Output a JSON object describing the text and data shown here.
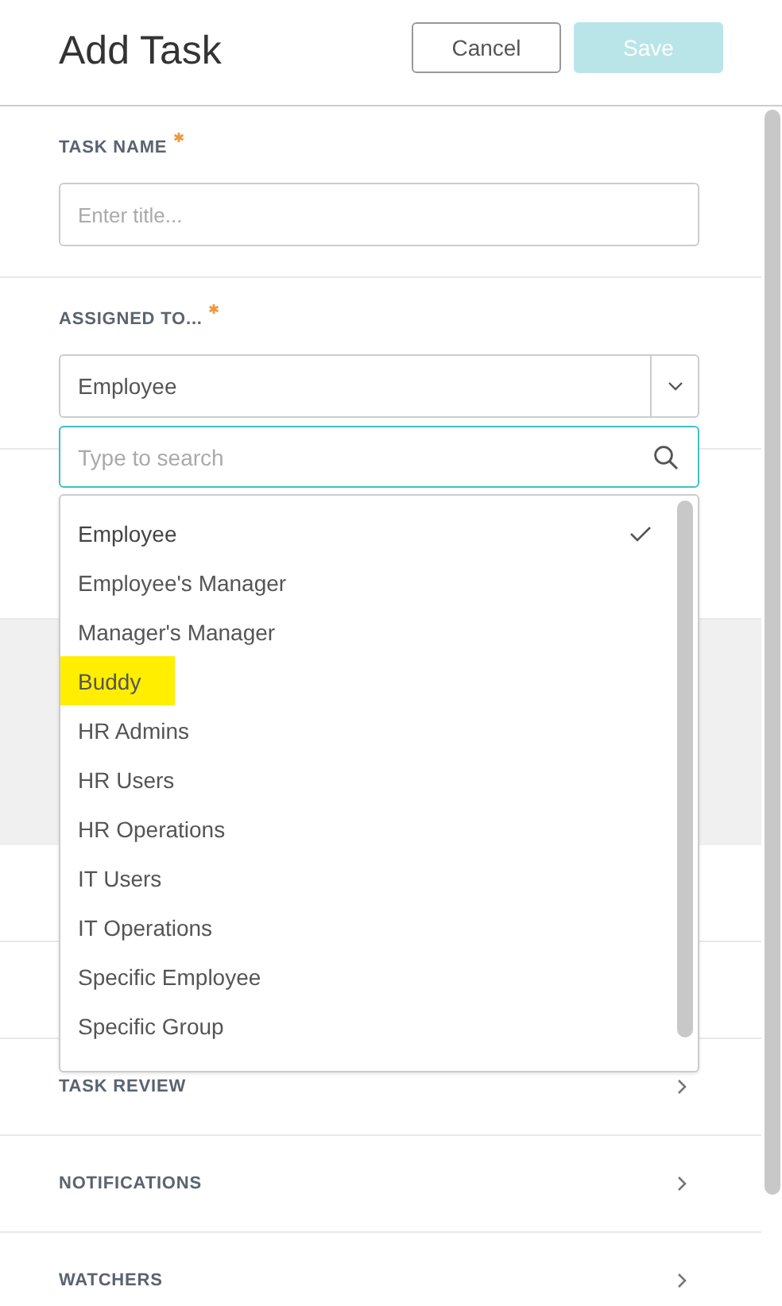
{
  "header": {
    "title": "Add Task",
    "buttons": [
      {
        "label": "Cancel",
        "kind": "secondary",
        "disabled": false
      },
      {
        "label": "Save",
        "kind": "primary",
        "disabled": true
      }
    ]
  },
  "task_name": {
    "label": "TASK NAME",
    "required": true,
    "placeholder": "Enter title..."
  },
  "assigned_to": {
    "label": "ASSIGNED TO...",
    "required": true,
    "value": "Employee",
    "search": {
      "placeholder": "Type to search"
    },
    "options": [
      {
        "label": "Employee",
        "selected": true,
        "highlighted": false
      },
      {
        "label": "Employee's Manager",
        "selected": false,
        "highlighted": false
      },
      {
        "label": "Manager's Manager",
        "selected": false,
        "highlighted": false
      },
      {
        "label": "Buddy",
        "selected": false,
        "highlighted": true
      },
      {
        "label": "HR Admins",
        "selected": false,
        "highlighted": false
      },
      {
        "label": "HR Users",
        "selected": false,
        "highlighted": false
      },
      {
        "label": "HR Operations",
        "selected": false,
        "highlighted": false
      },
      {
        "label": "IT Users",
        "selected": false,
        "highlighted": false
      },
      {
        "label": "IT Operations",
        "selected": false,
        "highlighted": false
      },
      {
        "label": "Specific Employee",
        "selected": false,
        "highlighted": false
      },
      {
        "label": "Specific Group",
        "selected": false,
        "highlighted": false
      }
    ]
  },
  "sections": [
    {
      "label": "TASK REVIEW"
    },
    {
      "label": "NOTIFICATIONS"
    },
    {
      "label": "WATCHERS"
    }
  ]
}
